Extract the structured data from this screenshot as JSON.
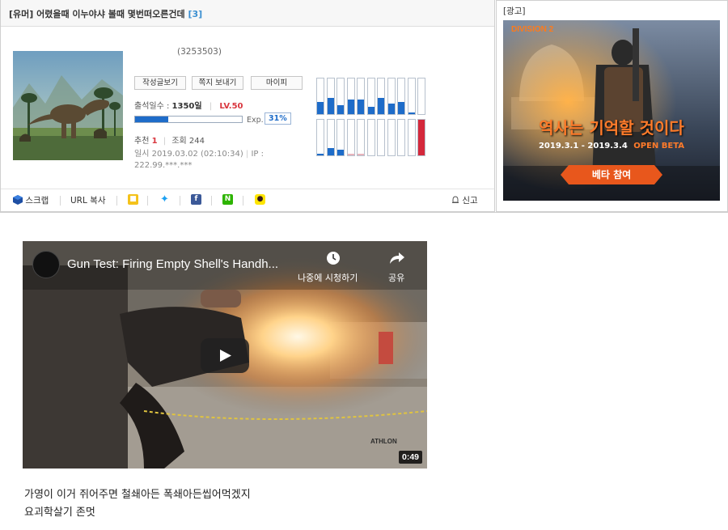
{
  "post": {
    "title": "[유머] 어렸을때 이누야샤 볼때 몇번떠오른건데",
    "comment_count": "[3]"
  },
  "profile": {
    "user_id": "(3253503)",
    "buttons": [
      "작성글보기",
      "쪽지 보내기",
      "마이피"
    ],
    "attendance_label": "출석일수 :",
    "attendance_value": "1350일",
    "level": "LV.50",
    "exp_label": "Exp.",
    "exp_percent": "31%",
    "exp_fraction": 0.31,
    "recommend_label": "추천",
    "recommend_value": "1",
    "views_label": "조회",
    "views_value": "244",
    "date": "일시 2019.03.02 (02:10:34)",
    "ip_label": "IP :",
    "ip_value": "222.99.***.***"
  },
  "activity_chart": {
    "top_row": [
      0.35,
      0.45,
      0.25,
      0.4,
      0.4,
      0.2,
      0.45,
      0.3,
      0.35,
      0.05,
      0.0
    ],
    "bottom_row": [
      0.05,
      0.2,
      0.15,
      0.05,
      0.05,
      0.0,
      0.0,
      0.0,
      0.0,
      0.0,
      1.0
    ],
    "top_color": "#1e6cc9",
    "bottom_colors": [
      "#1e6cc9",
      "#1e6cc9",
      "#1e6cc9",
      "#e8b4bc",
      "#e8b4bc",
      "#e8b4bc",
      "#e8b4bc",
      "#e8b4bc",
      "#e8b4bc",
      "#e8b4bc",
      "#d4283b"
    ]
  },
  "share": {
    "scrap": "스크랩",
    "url_copy": "URL 복사",
    "report": "신고",
    "icons": [
      "kakaostory-icon",
      "twitter-icon",
      "facebook-icon",
      "naver-icon",
      "kakaotalk-icon"
    ]
  },
  "ad": {
    "label": "[광고]",
    "game_logo": "DIVISION 2",
    "headline": "역사는 기억할 것이다",
    "dates": "2019.3.1 - 2019.3.4",
    "open_beta": "OPEN BETA",
    "cta": "베타 참여"
  },
  "video": {
    "title": "Gun Test: Firing Empty Shell's Handh...",
    "watch_later": "나중에 시청하기",
    "share": "공유",
    "duration": "0:49",
    "watermark": "ATHLON"
  },
  "body": {
    "line1": "가영이 이거 쥐어주면 철쇄아든 폭쇄아든씹어먹겠지",
    "line2": "요괴학살기 존멋"
  }
}
